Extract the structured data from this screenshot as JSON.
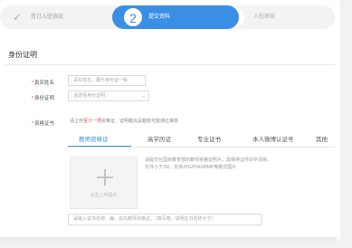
{
  "steps": {
    "step1_label": "签订入驻协议",
    "step2_number": "2",
    "step2_label": "提交资料",
    "step3_number": "3",
    "step3_label": "入驻审核"
  },
  "section": {
    "title": "身份证明"
  },
  "form": {
    "name_label": "真实姓名",
    "name_placeholder": "请实姓名，跟与身份证一致",
    "id_label": "身份证明",
    "id_select_value": "请选择身份证明",
    "cert_label": "资格证书",
    "hint_prefix": "请上传",
    "hint_emphasis": "至少一项",
    "hint_suffix": "资格证，证明越充足越有可能通过审核"
  },
  "tabs": [
    {
      "label": "教师资格证"
    },
    {
      "label": "高学历证"
    },
    {
      "label": "专业证书"
    },
    {
      "label": "本人微博认证号"
    },
    {
      "label": "其他"
    }
  ],
  "upload": {
    "label": "点击上传图片",
    "description": "请提交在国家教育部的教师资格证照片，需保持证件四字清晰，文件小于2M，支持JPG/PNG/BMP等格式图片"
  },
  "remark": {
    "placeholder": "请输入证书名称、编、说先教师资格证。（填写格，说明证书名称大于）"
  }
}
